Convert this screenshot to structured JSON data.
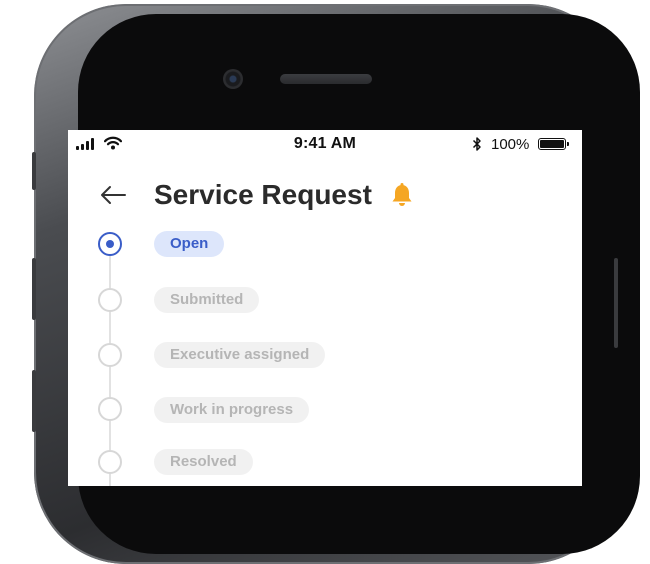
{
  "status_bar": {
    "time": "9:41 AM",
    "bluetooth_icon": "bluetooth-icon",
    "battery_percent": "100%"
  },
  "header": {
    "back_icon": "arrow-left-icon",
    "title": "Service Request",
    "bell_icon": "bell-icon",
    "bell_color": "#f5a623"
  },
  "timeline": {
    "accent_color": "#3a5dc8",
    "steps": [
      {
        "label": "Open",
        "active": true
      },
      {
        "label": "Submitted",
        "active": false
      },
      {
        "label": "Executive assigned",
        "active": false
      },
      {
        "label": "Work in progress",
        "active": false
      },
      {
        "label": "Resolved",
        "active": false
      }
    ]
  }
}
